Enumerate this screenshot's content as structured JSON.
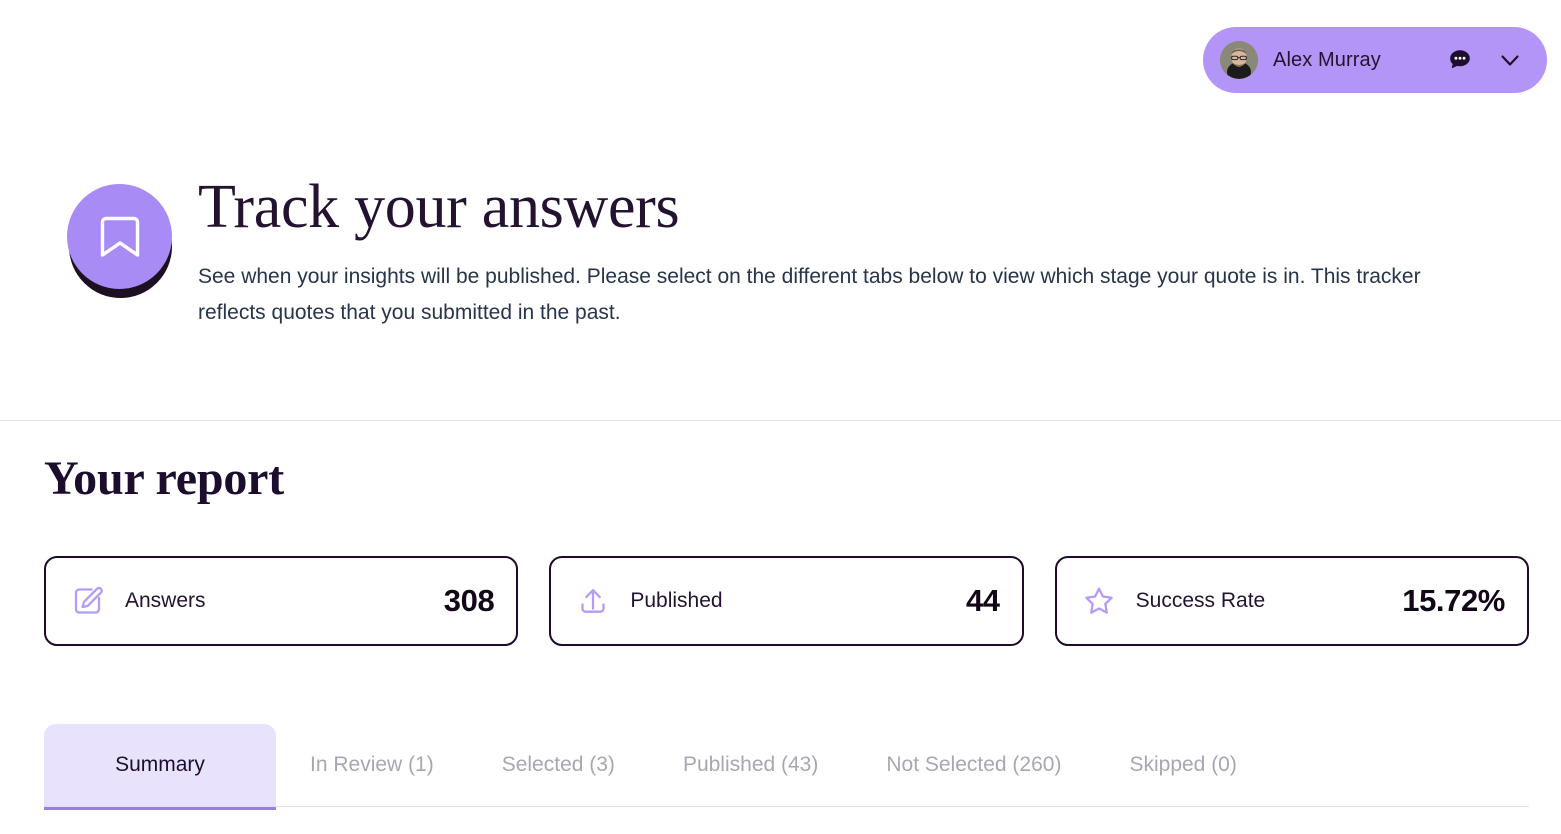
{
  "topbar": {
    "user": {
      "name": "Alex Murray",
      "avatar_alt": "user-avatar-photo",
      "chat_icon": "chat-bubble-icon",
      "expand_icon": "chevron-down-icon",
      "pill_color": "#B395F7"
    }
  },
  "hero": {
    "badge_icon": "bookmark-icon",
    "badge_color": "#A98BF5",
    "title": "Track your answers",
    "description": "See when your insights will be published. Please select on the different tabs below to view which stage your quote is in. This tracker reflects quotes that you submitted in the past."
  },
  "report": {
    "title": "Your report",
    "stats": [
      {
        "icon": "edit-pencil-icon",
        "label": "Answers",
        "value": "308"
      },
      {
        "icon": "upload-icon",
        "label": "Published",
        "value": "44"
      },
      {
        "icon": "star-icon",
        "label": "Success Rate",
        "value": "15.72%"
      }
    ],
    "tabs": [
      {
        "label": "Summary",
        "active": true
      },
      {
        "label": "In Review (1)",
        "active": false
      },
      {
        "label": "Selected (3)",
        "active": false
      },
      {
        "label": "Published (43)",
        "active": false
      },
      {
        "label": "Not Selected (260)",
        "active": false
      },
      {
        "label": "Skipped (0)",
        "active": false
      }
    ],
    "accent_color": "#9B7BF5",
    "active_tab_bg": "#E9E2FD"
  }
}
